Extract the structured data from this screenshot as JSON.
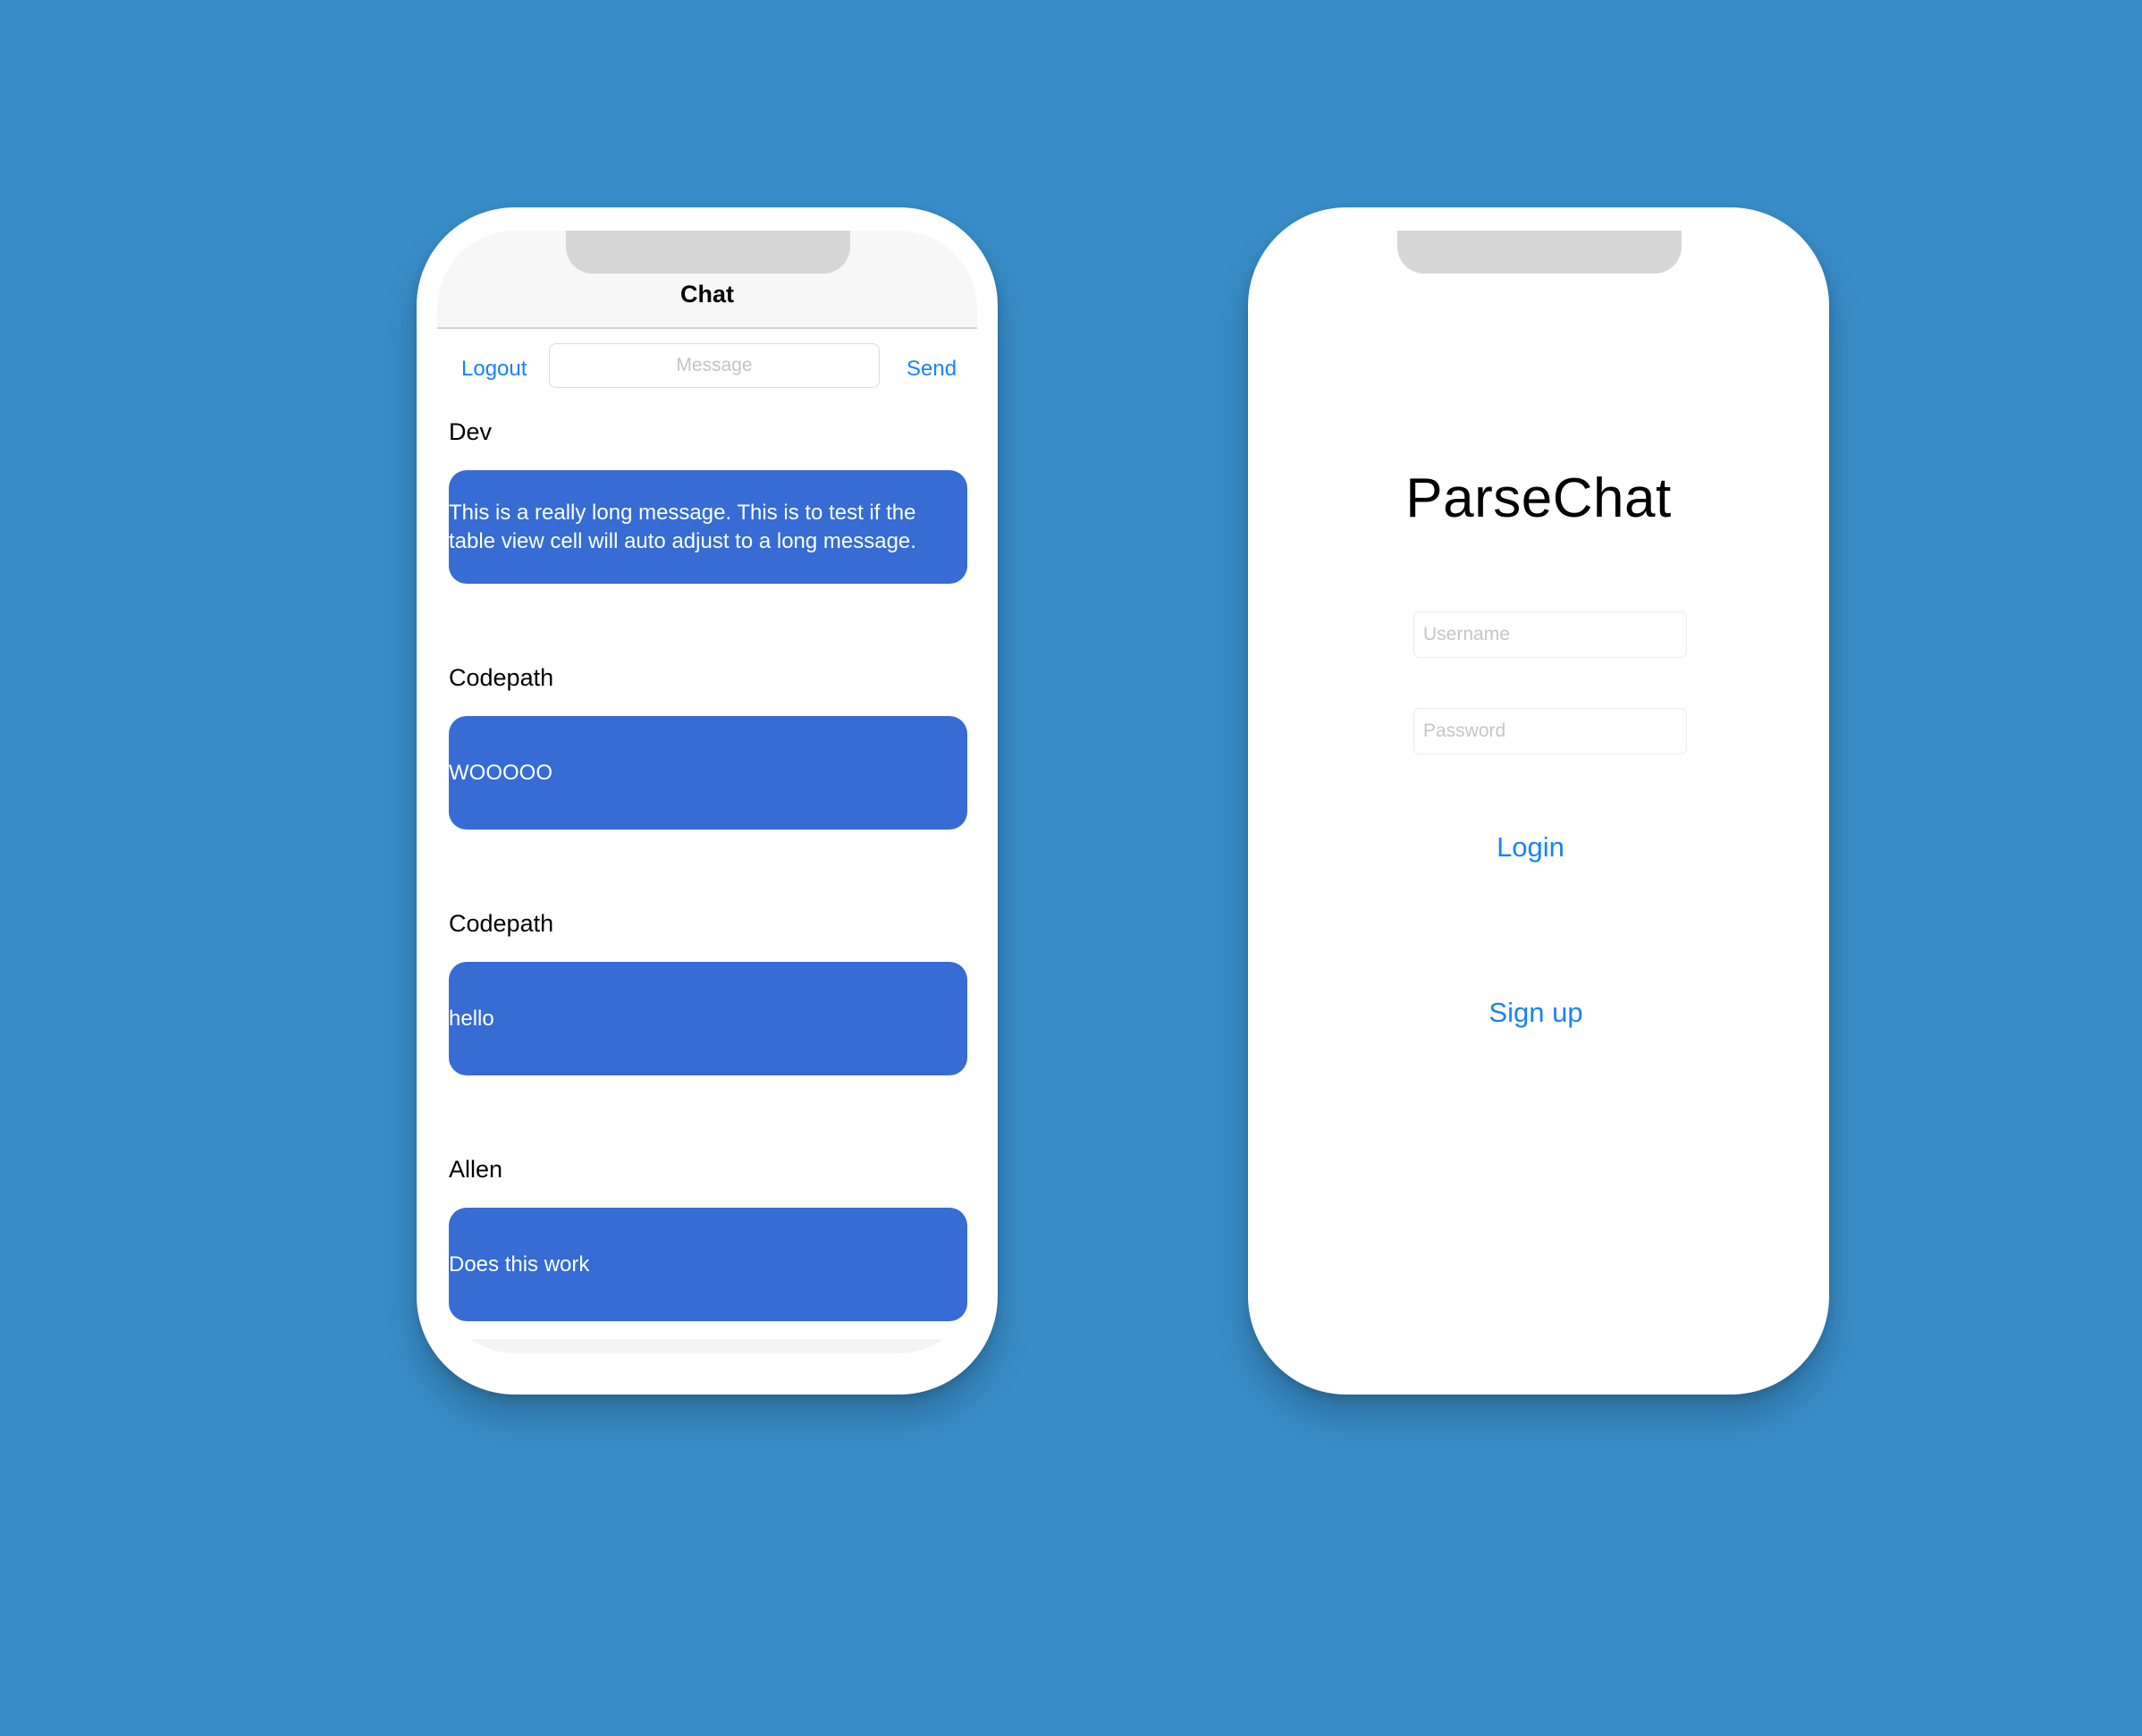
{
  "chat_screen": {
    "nav_title": "Chat",
    "logout_label": "Logout",
    "send_label": "Send",
    "message_input": {
      "placeholder": "Message",
      "value": ""
    },
    "messages": [
      {
        "user": "Dev",
        "text": "This is a really long message. This is to test if the table view cell will auto adjust to a long message."
      },
      {
        "user": "Codepath",
        "text": "WOOOOO"
      },
      {
        "user": "Codepath",
        "text": "hello"
      },
      {
        "user": "Allen",
        "text": "Does this work"
      }
    ]
  },
  "login_screen": {
    "app_title": "ParseChat",
    "username": {
      "placeholder": "Username",
      "value": ""
    },
    "password": {
      "placeholder": "Password",
      "value": ""
    },
    "login_label": "Login",
    "signup_label": "Sign up"
  },
  "colors": {
    "background": "#388dc8",
    "bubble": "#366cd3",
    "link": "#1a82fb",
    "notch": "#d6d6d6"
  }
}
